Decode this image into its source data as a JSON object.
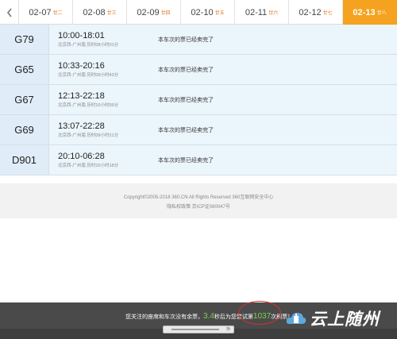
{
  "date_tabs": [
    {
      "date": "02-07",
      "lunar": "廿二",
      "active": false
    },
    {
      "date": "02-08",
      "lunar": "廿三",
      "active": false
    },
    {
      "date": "02-09",
      "lunar": "廿四",
      "active": false
    },
    {
      "date": "02-10",
      "lunar": "廿五",
      "active": false
    },
    {
      "date": "02-11",
      "lunar": "廿六",
      "active": false
    },
    {
      "date": "02-12",
      "lunar": "廿七",
      "active": false
    },
    {
      "date": "02-13",
      "lunar": "廿八",
      "active": true
    }
  ],
  "trains": [
    {
      "number": "G79",
      "time": "10:00-18:01",
      "route": "北京西-广州南",
      "duration": "历时08小时01分",
      "status": "本车次的票已经卖完了"
    },
    {
      "number": "G65",
      "time": "10:33-20:16",
      "route": "北京西-广州南",
      "duration": "历时09小时43分",
      "status": "本车次的票已经卖完了"
    },
    {
      "number": "G67",
      "time": "12:13-22:18",
      "route": "北京西-广州南",
      "duration": "历时10小时05分",
      "status": "本车次的票已经卖完了"
    },
    {
      "number": "G69",
      "time": "13:07-22:28",
      "route": "北京西-广州南",
      "duration": "历时09小时21分",
      "status": "本车次的票已经卖完了"
    },
    {
      "number": "D901",
      "time": "20:10-06:28",
      "route": "北京西-广州南",
      "duration": "历时10小时18分",
      "status": "本车次的票已经卖完了"
    }
  ],
  "footer": {
    "copyright": "Copyright©2005-2018 360.CN All Rights Reserved 360互联网安全中心",
    "links": "隐私权政策 京ICP证080047号"
  },
  "notice": {
    "prefix": "您关注的座席和车次没有余票，",
    "seconds": "3.4",
    "middle": "秒后为您尝试第",
    "count": "1037",
    "suffix": "次刷票！"
  },
  "scroll_label": "换",
  "watermark": "云上随州",
  "colors": {
    "accent": "#f4a21f",
    "highlight": "#7cd24c",
    "circle": "#d43030"
  }
}
